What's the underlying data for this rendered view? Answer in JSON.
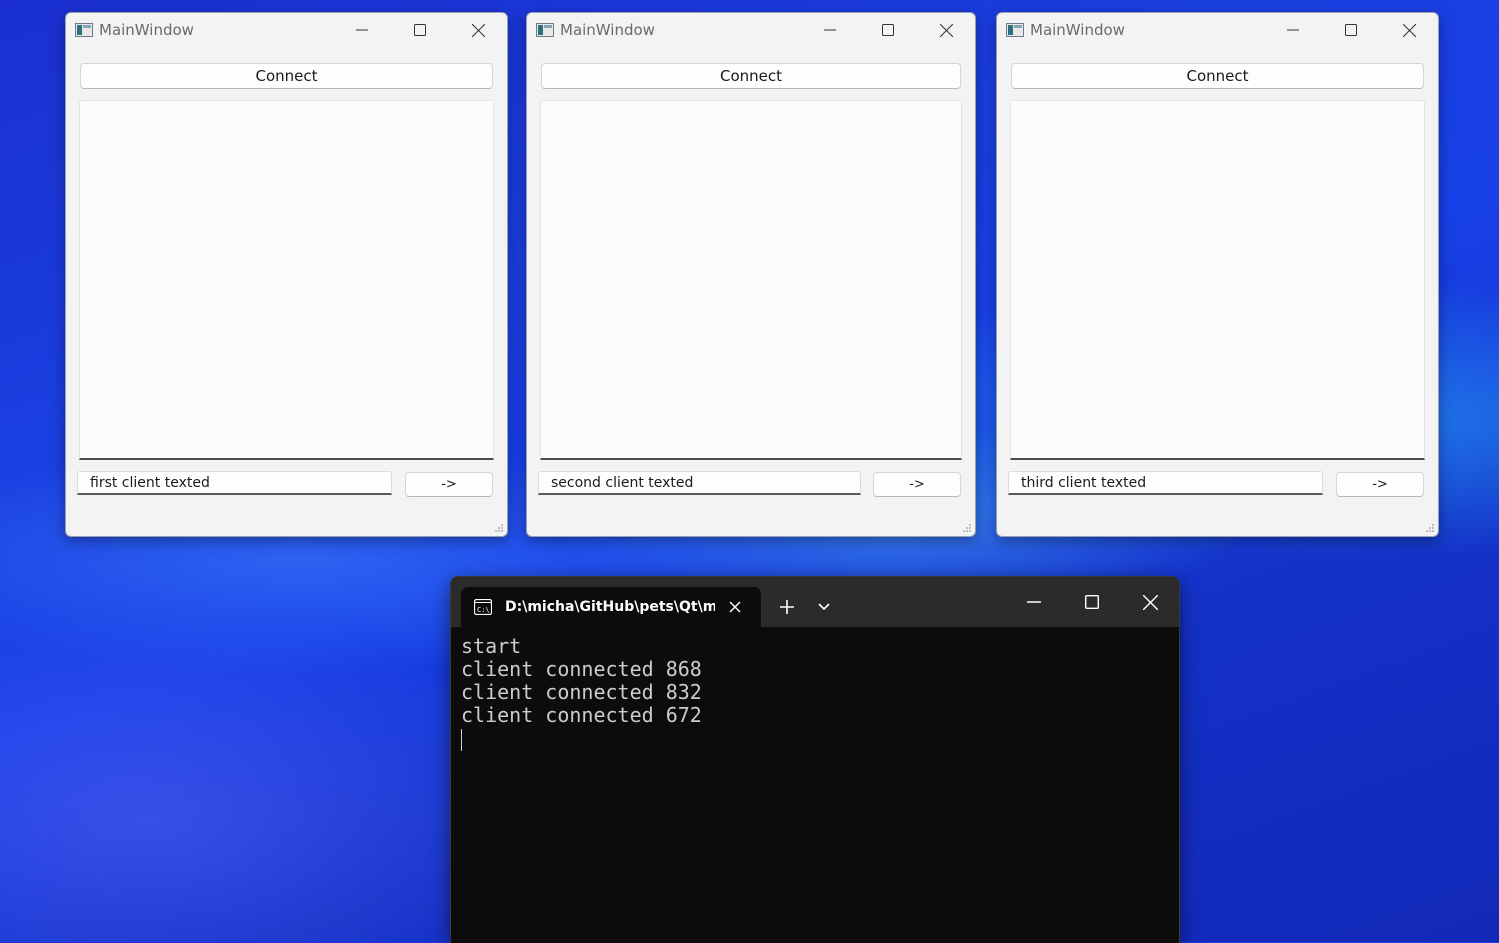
{
  "qt_windows": [
    {
      "title": "MainWindow",
      "connect_label": "Connect",
      "message_input_value": "first client texted",
      "send_label": "->"
    },
    {
      "title": "MainWindow",
      "connect_label": "Connect",
      "message_input_value": "second client texted",
      "send_label": "->"
    },
    {
      "title": "MainWindow",
      "connect_label": "Connect",
      "message_input_value": "third client texted",
      "send_label": "->"
    }
  ],
  "terminal": {
    "tab_title": "D:\\micha\\GitHub\\pets\\Qt\\me",
    "tab_icon": "cmd-icon",
    "lines": [
      "start",
      "client connected 868",
      "client connected 832",
      "client connected 672"
    ]
  },
  "colors": {
    "terminal_background": "#0c0c0c",
    "terminal_text": "#cccccc",
    "desktop_accent": "#1a3fe0"
  }
}
